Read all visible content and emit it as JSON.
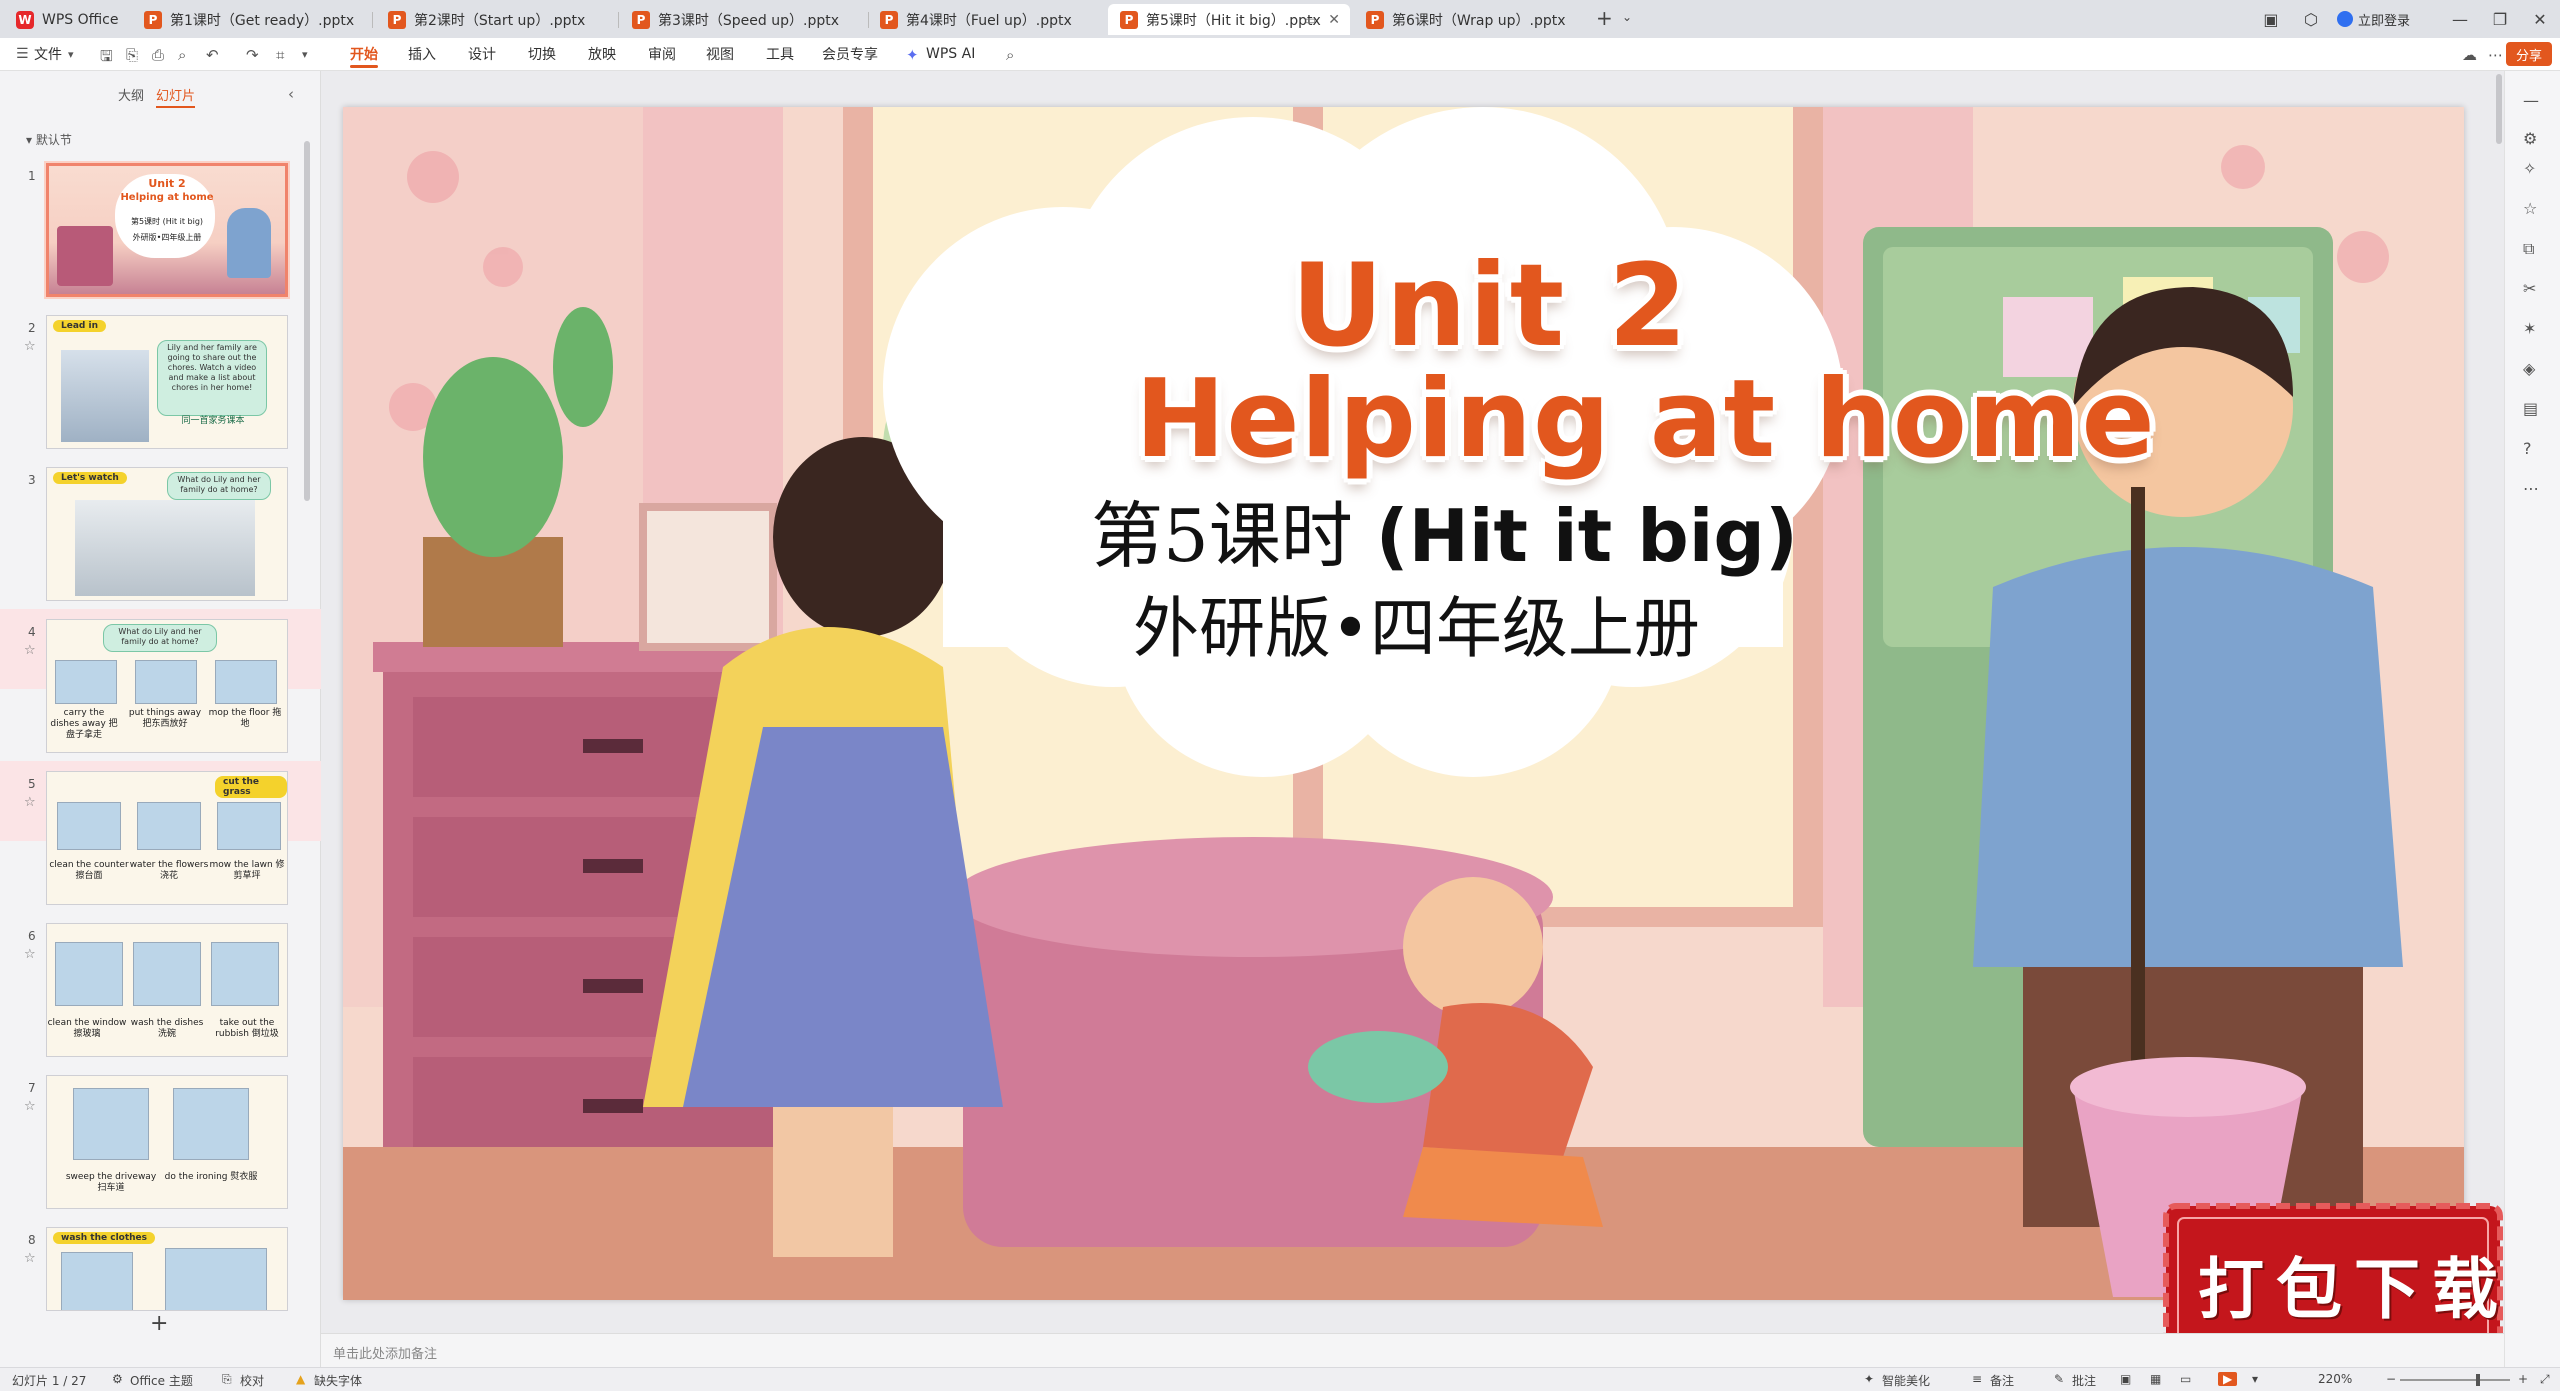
{
  "tabs": [
    {
      "label": "WPS Office",
      "type": "home"
    },
    {
      "label": "第1课时（Get ready）.pptx"
    },
    {
      "label": "第2课时（Start up）.pptx"
    },
    {
      "label": "第3课时（Speed up）.pptx"
    },
    {
      "label": "第4课时（Fuel up）.pptx"
    },
    {
      "label": "第5课时（Hit it big）.pptx",
      "active": true
    },
    {
      "label": "第6课时（Wrap up）.pptx"
    }
  ],
  "title_right": {
    "login": "立即登录"
  },
  "ribbon": {
    "file": "文件",
    "items": [
      "开始",
      "插入",
      "设计",
      "切换",
      "放映",
      "审阅",
      "视图",
      "工具",
      "会员专享",
      "WPS AI"
    ],
    "share": "分享"
  },
  "left_panel": {
    "tab_outline": "大纲",
    "tab_slides": "幻灯片",
    "section": "默认节",
    "slides": [
      {
        "num": "1",
        "title": "Unit 2",
        "subtitle": "Helping at home",
        "line": "第5课时 (Hit it big)",
        "line2": "外研版•四年级上册"
      },
      {
        "num": "2",
        "tag": "Lead in",
        "bubble": "Lily and her family are going to share out the chores. Watch a video and make a list about chores in her home!",
        "caption": "同一首家务课本"
      },
      {
        "num": "3",
        "tag": "Let's watch",
        "bubble": "What do Lily and her family do at home?"
      },
      {
        "num": "4",
        "bubble": "What do Lily and her family do at home?",
        "labels": [
          "carry the dishes away 把盘子拿走",
          "put things away 把东西放好",
          "mop the floor 拖地"
        ]
      },
      {
        "num": "5",
        "tag_right": "cut the grass",
        "labels": [
          "clean the counter 擦台面",
          "water the flowers 浇花",
          "mow the lawn 修剪草坪"
        ]
      },
      {
        "num": "6",
        "labels": [
          "clean the window 擦玻璃",
          "wash the dishes 洗碗",
          "take out the rubbish 倒垃圾"
        ]
      },
      {
        "num": "7",
        "labels": [
          "sweep the driveway 扫车道",
          "do the ironing 熨衣服"
        ]
      },
      {
        "num": "8",
        "tag": "wash the clothes"
      }
    ],
    "add": "+"
  },
  "slide": {
    "title_line1": "Unit 2",
    "title_line2": "Helping at home",
    "subtitle_cn": "第5课时",
    "subtitle_en": "(Hit it big)",
    "edition": "外研版•四年级上册",
    "download_badge": "打包下载",
    "colors": {
      "title": "#e2571e",
      "wall": "#f6d6c9",
      "cabinet": "#c26a82",
      "tablecloth": "#d07b97"
    }
  },
  "notes_placeholder": "单击此处添加备注",
  "status": {
    "slide_info": "幻灯片 1 / 27",
    "theme": "Office 主题",
    "proof": "校对",
    "missing_font": "缺失字体",
    "beautify": "智能美化",
    "notes": "备注",
    "comment": "批注",
    "zoom": "220%"
  }
}
